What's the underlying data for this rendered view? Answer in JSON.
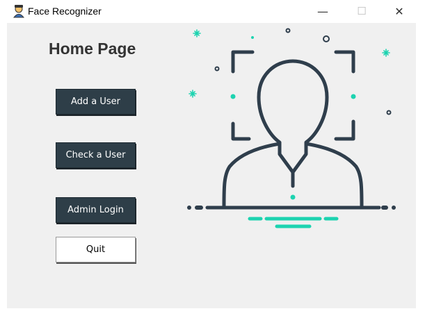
{
  "window": {
    "title": "Face Recognizer",
    "controls": {
      "minimize": "—",
      "maximize": "☐",
      "close": "✕"
    }
  },
  "home": {
    "title": "Home Page",
    "buttons": {
      "add_user": "Add a User",
      "check_user": "Check a User",
      "admin_login": "Admin Login",
      "quit": "Quit"
    }
  },
  "illustration": {
    "icon": "face-scan-user-icon"
  },
  "colors": {
    "dark_button": "#2e3e48",
    "illustration_stroke": "#2f3e4c",
    "accent_teal": "#1dd3b0",
    "background": "#f0f0f0"
  }
}
